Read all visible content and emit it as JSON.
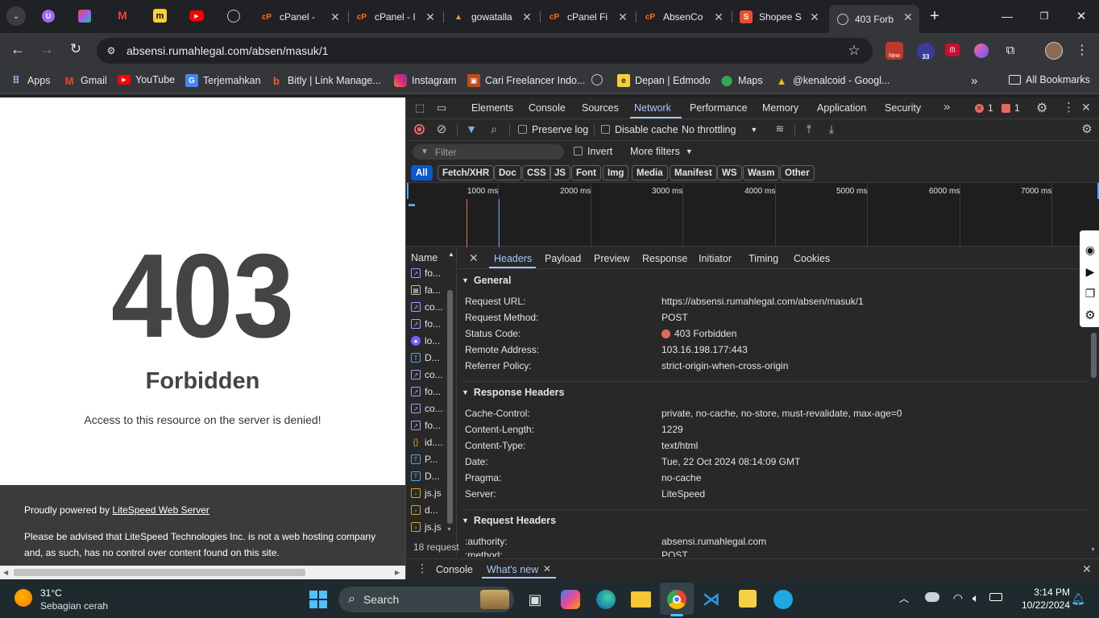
{
  "tabs": [
    {
      "title": "cPanel - ",
      "fav": "cP"
    },
    {
      "title": "cPanel - I",
      "fav": "cP"
    },
    {
      "title": "gowatalla",
      "fav": "G"
    },
    {
      "title": "cPanel Fi",
      "fav": "cP"
    },
    {
      "title": "AbsenCo",
      "fav": "cP"
    },
    {
      "title": "Shopee S",
      "fav": "S"
    },
    {
      "title": "403 Forb",
      "fav": "🌐"
    }
  ],
  "address": {
    "url": "absensi.rumahlegal.com/absen/masuk/1"
  },
  "extensions": {
    "new_badge": "New",
    "count_badge": "33"
  },
  "bookmarks": [
    "Apps",
    "Gmail",
    "YouTube",
    "Terjemahkan",
    "Bitly | Link Manage...",
    "Instagram",
    "Cari Freelancer Indo...",
    "",
    "Depan | Edmodo",
    "Maps",
    "@kenalcoid - Googl...",
    "All Bookmarks"
  ],
  "page": {
    "code": "403",
    "title": "Forbidden",
    "message": "Access to this resource on the server is denied!",
    "powered_prefix": "Proudly powered by ",
    "powered_link": "LiteSpeed Web Server",
    "notice": "Please be advised that LiteSpeed Technologies Inc. is not a web hosting company and, as such, has no control over content found on this site."
  },
  "devtools": {
    "tabs": [
      "Elements",
      "Console",
      "Sources",
      "Network",
      "Performance",
      "Memory",
      "Application",
      "Security"
    ],
    "active_tab": "Network",
    "errors": "1",
    "warnings": "1",
    "preserve_log": "Preserve log",
    "disable_cache": "Disable cache",
    "throttling": "No throttling",
    "filter_placeholder": "Filter",
    "invert": "Invert",
    "more_filters": "More filters",
    "types": [
      "All",
      "Fetch/XHR",
      "Doc",
      "CSS",
      "JS",
      "Font",
      "Img",
      "Media",
      "Manifest",
      "WS",
      "Wasm",
      "Other"
    ],
    "timeline": [
      "1000 ms",
      "2000 ms",
      "3000 ms",
      "4000 ms",
      "5000 ms",
      "6000 ms",
      "7000 ms"
    ],
    "name_header": "Name",
    "requests": [
      "fo...",
      "fa...",
      "co...",
      "fo...",
      "lo...",
      "D...",
      "co...",
      "fo...",
      "co...",
      "fo...",
      "id....",
      "P...",
      "D...",
      "js.js",
      "d...",
      "js.js"
    ],
    "requests_count": "18 request",
    "detail_tabs": [
      "Headers",
      "Payload",
      "Preview",
      "Response",
      "Initiator",
      "Timing",
      "Cookies"
    ],
    "general": {
      "title": "General",
      "rows": [
        [
          "Request URL:",
          "https://absensi.rumahlegal.com/absen/masuk/1"
        ],
        [
          "Request Method:",
          "POST"
        ],
        [
          "Status Code:",
          "403 Forbidden"
        ],
        [
          "Remote Address:",
          "103.16.198.177:443"
        ],
        [
          "Referrer Policy:",
          "strict-origin-when-cross-origin"
        ]
      ]
    },
    "response_headers": {
      "title": "Response Headers",
      "rows": [
        [
          "Cache-Control:",
          "private, no-cache, no-store, must-revalidate, max-age=0"
        ],
        [
          "Content-Length:",
          "1229"
        ],
        [
          "Content-Type:",
          "text/html"
        ],
        [
          "Date:",
          "Tue, 22 Oct 2024 08:14:09 GMT"
        ],
        [
          "Pragma:",
          "no-cache"
        ],
        [
          "Server:",
          "LiteSpeed"
        ]
      ]
    },
    "request_headers": {
      "title": "Request Headers",
      "rows": [
        [
          ":authority:",
          "absensi.rumahlegal.com"
        ],
        [
          ":method:",
          "POST"
        ]
      ]
    },
    "drawer": {
      "console": "Console",
      "whats_new": "What's new"
    }
  },
  "taskbar": {
    "temp": "31°C",
    "weather": "Sebagian cerah",
    "search": "Search",
    "time": "3:14 PM",
    "date": "10/22/2024"
  }
}
